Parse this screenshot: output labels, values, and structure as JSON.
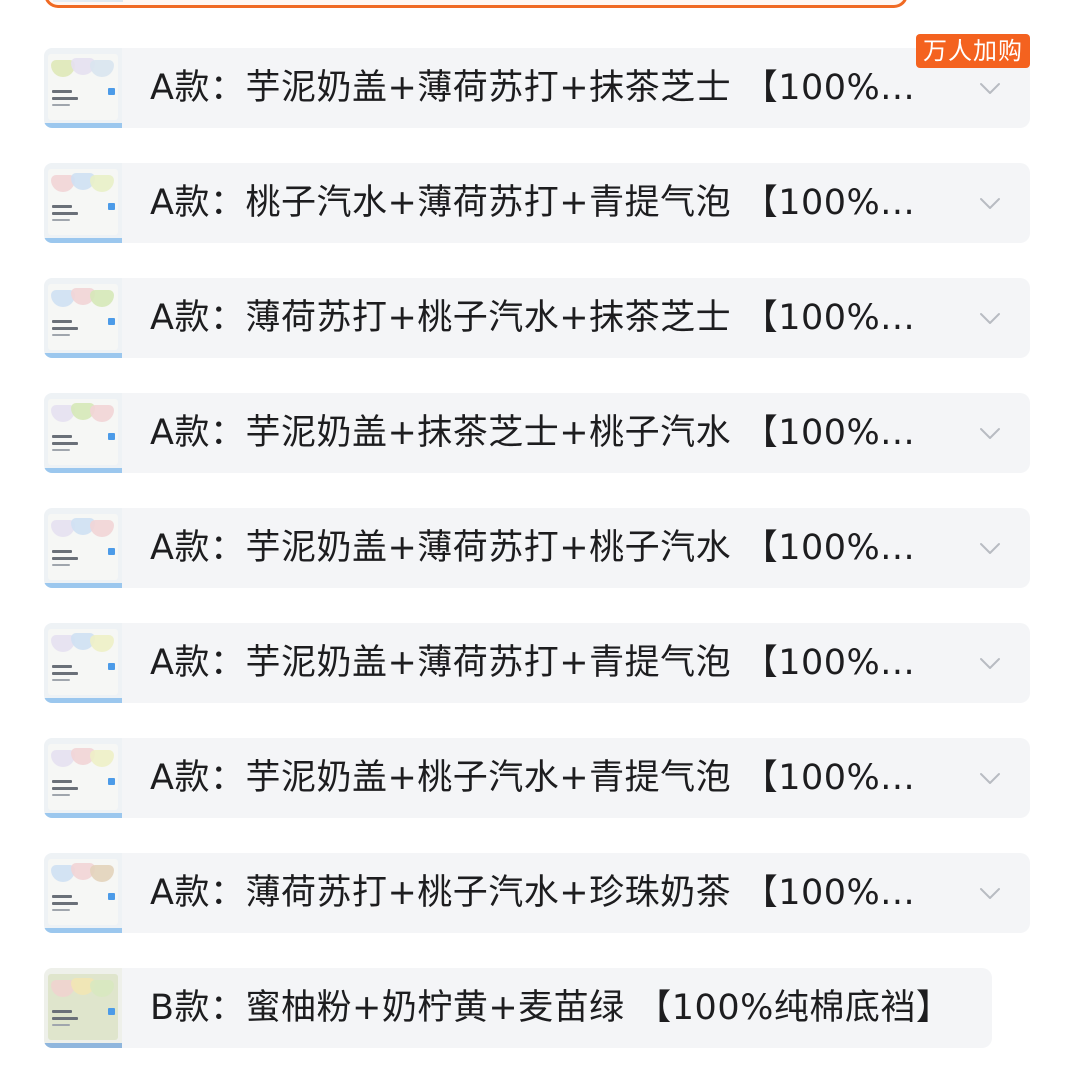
{
  "options": [
    {
      "label": "A款：芋泥奶盖+薄荷苏打+抹茶芝士 【100%...",
      "badge": "万人加购",
      "colors": [
        "#dfe8b8",
        "#e6e0f1",
        "#d9e4f0"
      ]
    },
    {
      "label": "A款：桃子汽水+薄荷苏打+青提气泡 【100%...",
      "badge": "",
      "colors": [
        "#f2d4d6",
        "#cfe0f3",
        "#e9f0c8"
      ]
    },
    {
      "label": "A款：薄荷苏打+桃子汽水+抹茶芝士 【100%...",
      "badge": "",
      "colors": [
        "#cfe0f3",
        "#f2d4d6",
        "#d6e8b8"
      ]
    },
    {
      "label": "A款：芋泥奶盖+抹茶芝士+桃子汽水 【100%...",
      "badge": "",
      "colors": [
        "#e6e0f1",
        "#d6e8b8",
        "#f2d4d6"
      ]
    },
    {
      "label": "A款：芋泥奶盖+薄荷苏打+桃子汽水 【100%...",
      "badge": "",
      "colors": [
        "#e6e0f1",
        "#cfe0f3",
        "#f2d4d6"
      ]
    },
    {
      "label": "A款：芋泥奶盖+薄荷苏打+青提气泡 【100%...",
      "badge": "",
      "colors": [
        "#e6e0f1",
        "#cfe0f3",
        "#eef0c6"
      ]
    },
    {
      "label": "A款：芋泥奶盖+桃子汽水+青提气泡 【100%...",
      "badge": "",
      "colors": [
        "#e6e0f1",
        "#f2d4d6",
        "#eef0c6"
      ]
    },
    {
      "label": "A款：薄荷苏打+桃子汽水+珍珠奶茶 【100%...",
      "badge": "",
      "colors": [
        "#cfe0f3",
        "#f2d4d6",
        "#e3d3bb"
      ]
    },
    {
      "label": "B款：蜜柚粉+奶柠黄+麦苗绿 【100%纯棉底裆】",
      "badge": "",
      "colors": [
        "#f0d3cf",
        "#f2e6b4",
        "#d8e8c0"
      ]
    }
  ],
  "icons": {
    "expand": "chevron-down-icon"
  },
  "colors": {
    "selected_border": "#f06a23",
    "badge_bg": "#f4621f",
    "row_bg": "#f4f5f7"
  }
}
